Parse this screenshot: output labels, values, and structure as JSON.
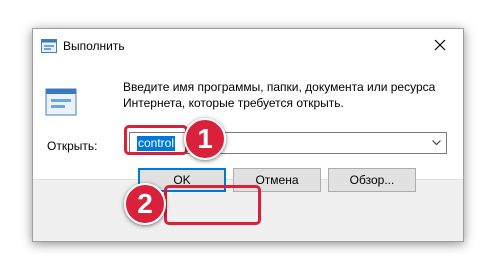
{
  "window": {
    "title": "Выполнить",
    "icon": "run-icon",
    "close_icon": "close-icon"
  },
  "dialog": {
    "icon": "run-program-icon",
    "description_line1": "Введите имя программы, папки, документа или ресурса",
    "description_line2": "Интернета, которые требуется открыть.",
    "open_label": "Открыть:",
    "open_value": "control"
  },
  "buttons": {
    "ok": "OK",
    "cancel": "Отмена",
    "browse": "Обзор..."
  },
  "annotations": {
    "step1": "1",
    "step2": "2",
    "highlight_color": "#d9213b"
  },
  "colors": {
    "selection": "#0078d7",
    "footer": "#f0f0f0"
  }
}
